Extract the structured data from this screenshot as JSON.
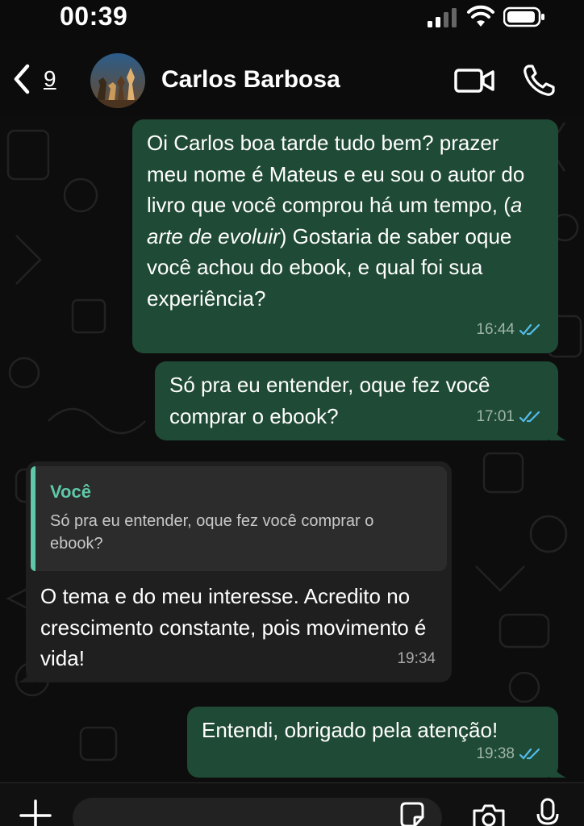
{
  "status_bar": {
    "time": "00:39"
  },
  "header": {
    "back_count": "9",
    "contact_name": "Carlos Barbosa",
    "icons": [
      "chevron-left-icon",
      "video-call-icon",
      "phone-call-icon"
    ]
  },
  "messages": [
    {
      "direction": "outgoing",
      "text": "Oi Carlos boa tarde tudo bem? prazer meu nome é Mateus e eu sou o autor do livro que você comprou há um tempo, (a arte de evoluir) Gostaria de saber oque você achou do ebook, e qual foi sua experiência?",
      "text_before": "Oi Carlos boa tarde tudo bem? prazer meu nome é Mateus e eu sou o autor do livro que você comprou há um tempo, (",
      "text_italic": "a arte de evoluir",
      "text_after": ") Gostaria de saber oque você achou do ebook, e qual foi sua experiência?",
      "time": "16:44",
      "status": "read"
    },
    {
      "direction": "outgoing",
      "text": "Só pra eu entender, oque fez você comprar o ebook?",
      "time": "17:01",
      "status": "read"
    },
    {
      "direction": "incoming",
      "quote_author": "Você",
      "quote_text": "Só pra eu entender, oque fez você comprar o ebook?",
      "text": "O tema e do meu interesse. Acredito no crescimento constante, pois movimento é vida!",
      "time": "19:34"
    },
    {
      "direction": "outgoing",
      "text": "Entendi, obrigado pela atenção!",
      "time": "19:38",
      "status": "read"
    }
  ],
  "colors": {
    "outgoing_bubble": "#1f4a35",
    "incoming_bubble": "#1f1f1f",
    "quote_accent": "#5fc8a8",
    "read_ticks": "#53bdeb"
  }
}
